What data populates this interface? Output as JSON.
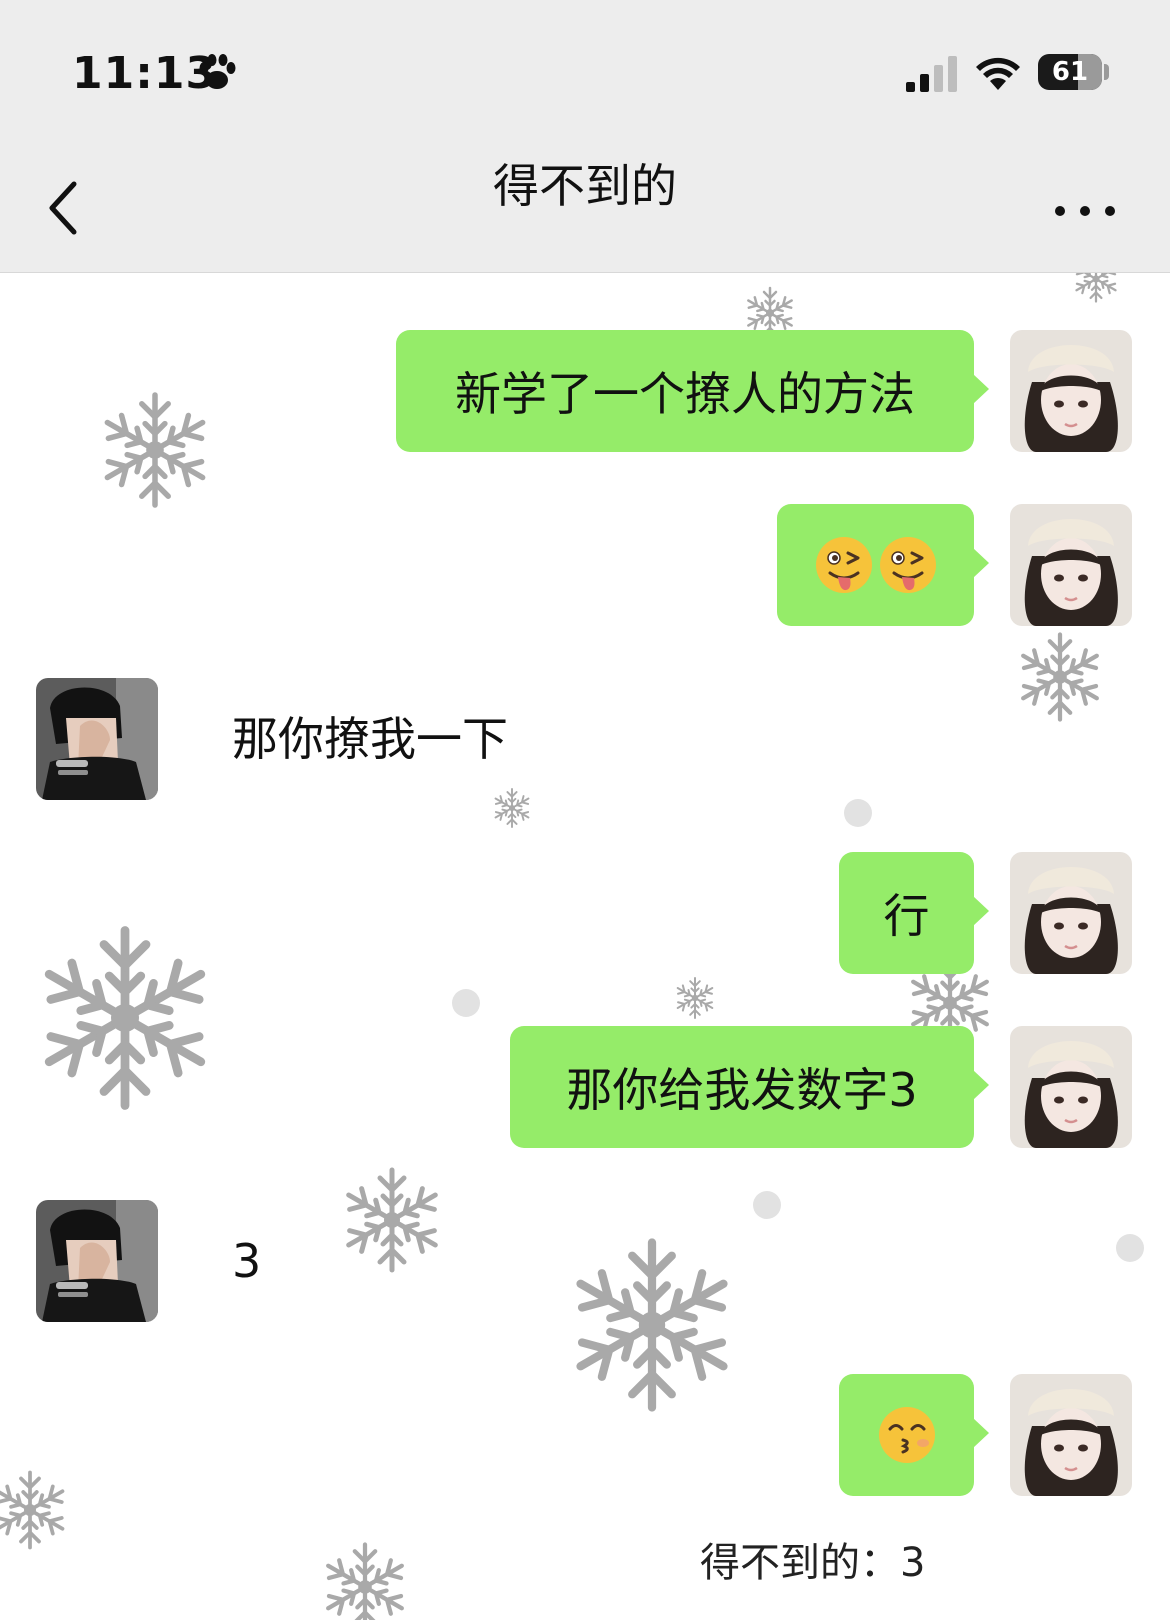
{
  "status_bar": {
    "time": "11:13",
    "time_emoji_icon": "paw-icon",
    "signal_icon": "cellular-signal-icon",
    "wifi_icon": "wifi-icon",
    "battery_level": "61"
  },
  "header": {
    "title": "得不到的",
    "back_icon": "chevron-left-icon",
    "more_icon": "more-dots-icon"
  },
  "colors": {
    "bar_bg": "#ededed",
    "bubble_out": "#95ec69",
    "chat_bg": "#ffffff",
    "snowflake": "#a9a9a9"
  },
  "messages": [
    {
      "from": "me",
      "text": "新学了一个撩人的方法"
    },
    {
      "from": "me",
      "emoji": [
        "winking-tongue-emoji",
        "winking-tongue-emoji"
      ]
    },
    {
      "from": "other",
      "text": "那你撩我一下"
    },
    {
      "from": "me",
      "text": "行"
    },
    {
      "from": "me",
      "text": "那你给我发数字3"
    },
    {
      "from": "other",
      "text": "3"
    },
    {
      "from": "me",
      "emoji": [
        "kissing-emoji"
      ]
    }
  ],
  "quoted_reply": "得不到的：3",
  "background_decoration": "snowflake-pattern"
}
